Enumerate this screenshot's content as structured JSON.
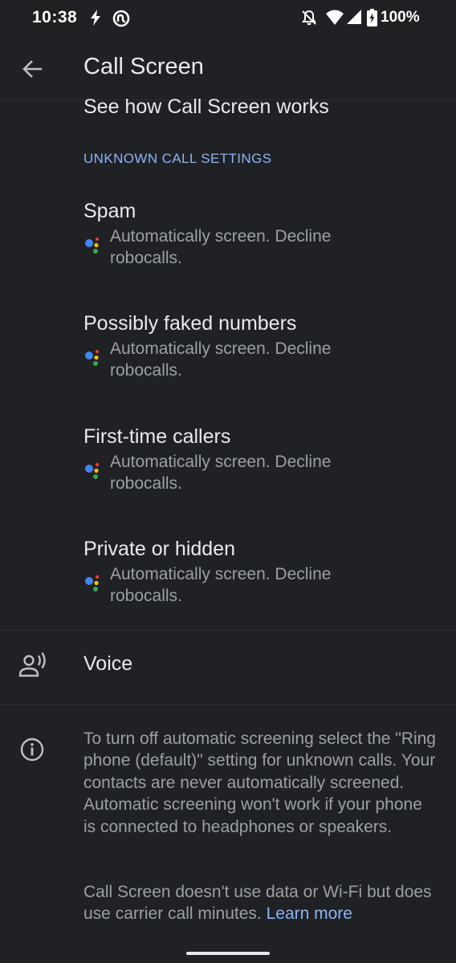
{
  "status_bar": {
    "time": "10:38",
    "battery": "100%",
    "icons": [
      "flash-icon",
      "nfc-icon",
      "do-not-disturb-icon",
      "wifi-icon",
      "signal-icon",
      "battery-charging-icon"
    ]
  },
  "app_bar": {
    "title": "Call Screen",
    "back_icon": "arrow-back-icon"
  },
  "see_how_link": "See how Call Screen works",
  "section_header": "UNKNOWN CALL SETTINGS",
  "settings": [
    {
      "title": "Spam",
      "summary": "Automatically screen. Decline robocalls."
    },
    {
      "title": "Possibly faked numbers",
      "summary": "Automatically screen. Decline robocalls."
    },
    {
      "title": "First-time callers",
      "summary": "Automatically screen. Decline robocalls."
    },
    {
      "title": "Private or hidden",
      "summary": "Automatically screen. Decline robocalls."
    }
  ],
  "voice": {
    "label": "Voice",
    "icon": "record-voice-icon"
  },
  "info": {
    "icon": "info-icon",
    "paragraph_1": "To turn off automatic screening select the \"Ring phone (default)\" setting for unknown calls. Your contacts are never automatically screened. Automatic screening won't work if your phone is connected to headphones or speakers.",
    "paragraph_2": "Call Screen doesn't use data or Wi-Fi but does use carrier call minutes.",
    "learn_more": "Learn more"
  },
  "colors": {
    "background": "#202124",
    "accent": "#8ab4f8",
    "primary_text": "#e8eaed",
    "secondary_text": "#9aa0a6"
  }
}
